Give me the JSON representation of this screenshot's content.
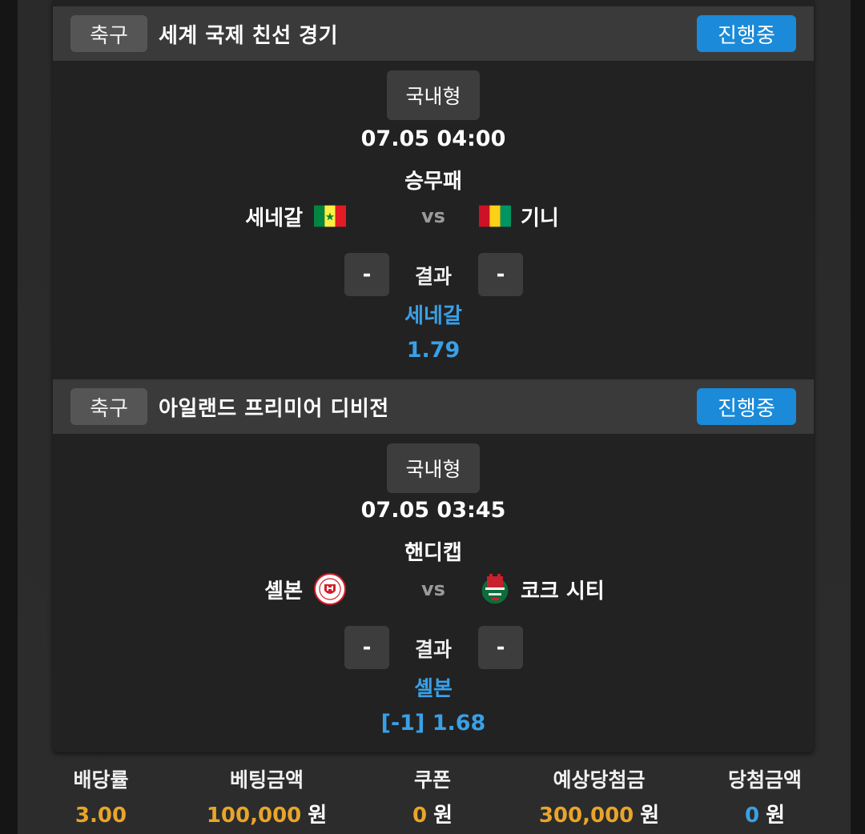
{
  "matches": [
    {
      "sport": "축구",
      "league": "세계 국제 친선 경기",
      "status": "진행중",
      "type": "국내형",
      "datetime": "07.05 04:00",
      "bet_type": "승무패",
      "home_team": "세네갈",
      "away_team": "기니",
      "home_logo": "senegal-flag-icon",
      "away_logo": "guinea-flag-icon",
      "vs": "vs",
      "home_score": "-",
      "away_score": "-",
      "result_label": "결과",
      "pick": "세네갈",
      "odds": "1.79"
    },
    {
      "sport": "축구",
      "league": "아일랜드 프리미어 디비전",
      "status": "진행중",
      "type": "국내형",
      "datetime": "07.05 03:45",
      "bet_type": "핸디캡",
      "home_team": "셸본",
      "away_team": "코크 시티",
      "home_logo": "shelbourne-crest-icon",
      "away_logo": "cork-city-crest-icon",
      "vs": "vs",
      "home_score": "-",
      "away_score": "-",
      "result_label": "결과",
      "pick": "셸본",
      "odds": "[-1] 1.68"
    }
  ],
  "summary": {
    "odds_label": "배당률",
    "odds_value": "3.00",
    "bet_label": "베팅금액",
    "bet_value": "100,000",
    "coupon_label": "쿠폰",
    "coupon_value": "0",
    "expected_label": "예상당첨금",
    "expected_value": "300,000",
    "win_label": "당첨금액",
    "win_value": "0",
    "unit": "원"
  },
  "colors": {
    "accent_blue": "#1a8ad9",
    "pick_blue": "#3aa0e6",
    "amount_orange": "#e8a52a"
  }
}
